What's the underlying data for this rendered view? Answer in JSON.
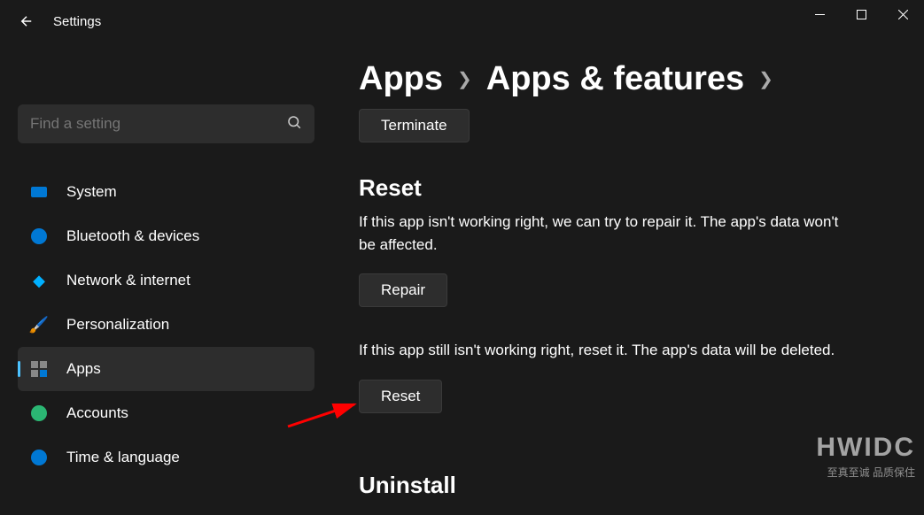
{
  "app_title": "Settings",
  "search": {
    "placeholder": "Find a setting"
  },
  "sidebar": {
    "items": [
      {
        "label": "System"
      },
      {
        "label": "Bluetooth & devices"
      },
      {
        "label": "Network & internet"
      },
      {
        "label": "Personalization"
      },
      {
        "label": "Apps"
      },
      {
        "label": "Accounts"
      },
      {
        "label": "Time & language"
      }
    ]
  },
  "breadcrumb": {
    "level1": "Apps",
    "level2": "Apps & features"
  },
  "content": {
    "terminate_button": "Terminate",
    "reset_heading": "Reset",
    "repair_text": "If this app isn't working right, we can try to repair it. The app's data won't be affected.",
    "repair_button": "Repair",
    "reset_text": "If this app still isn't working right, reset it. The app's data will be deleted.",
    "reset_button": "Reset",
    "uninstall_heading": "Uninstall"
  },
  "watermark": {
    "big": "HWIDC",
    "small": "至真至诚 品质保住"
  }
}
